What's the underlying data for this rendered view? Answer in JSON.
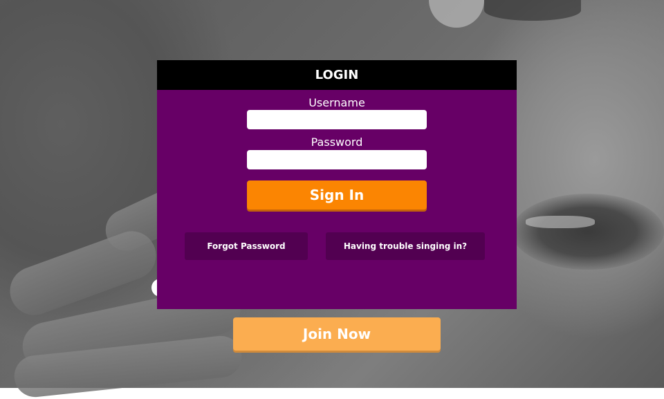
{
  "login": {
    "title": "LOGIN",
    "username_label": "Username",
    "username_value": "",
    "password_label": "Password",
    "password_value": "",
    "signin_label": "Sign In",
    "forgot_label": "Forgot Password",
    "trouble_label": "Having trouble singing in?"
  },
  "join": {
    "label": "Join Now"
  },
  "colors": {
    "modal_bg": "#670066",
    "header_bg": "#000000",
    "signin_bg": "#fb8502",
    "link_bg": "#520051",
    "join_bg": "#fbad50"
  }
}
